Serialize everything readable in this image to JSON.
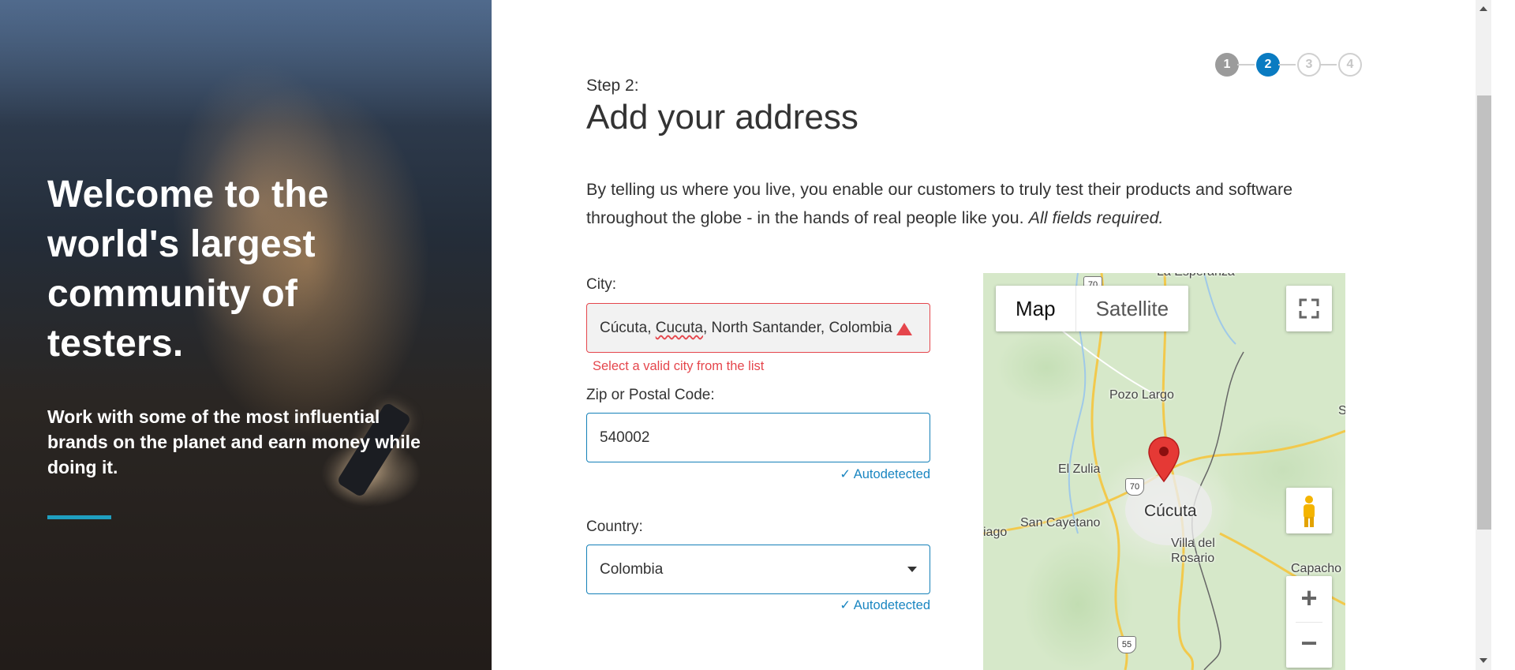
{
  "hero": {
    "title": "Welcome to the world's largest community of testers.",
    "subtitle": "Work with some of the most influential brands on the planet and earn money while doing it.",
    "accent_color": "#1f9fc0"
  },
  "stepper": {
    "steps": [
      "1",
      "2",
      "3",
      "4"
    ],
    "current": 2
  },
  "form": {
    "step_label": "Step 2:",
    "title": "Add your address",
    "intro": "By telling us where you live, you enable our customers to truly test their products and software throughout the globe - in the hands of real people like you.",
    "intro_required": "All fields required.",
    "city": {
      "label": "City:",
      "value_prefix": "Cúcuta, ",
      "value_misspelled": "Cucuta",
      "value_suffix": ", North Santander, Colombia",
      "error": "Select a valid city from the list"
    },
    "zip": {
      "label": "Zip or Postal Code:",
      "value": "540002",
      "status": "Autodetected"
    },
    "country": {
      "label": "Country:",
      "value": "Colombia",
      "status": "Autodetected"
    }
  },
  "map": {
    "type_buttons": [
      "Map",
      "Satellite"
    ],
    "selected_type": "Map",
    "places": {
      "top": "La Esperanza",
      "pozo_largo": "Pozo Largo",
      "el_zulia": "El Zulia",
      "cucuta": "Cúcuta",
      "san_cayetano": "San Cayetano",
      "iago": "iago",
      "villa_del_rosario": "Villa del Rosario",
      "capacho": "Capacho V",
      "s": "S"
    },
    "route_shields": [
      "70",
      "70",
      "55"
    ],
    "zoom_in": "+",
    "zoom_out": "−",
    "pin_color": "#e53935"
  },
  "colors": {
    "primary": "#0a7bc1",
    "error": "#e5464c",
    "success_text": "#1a86c1"
  }
}
